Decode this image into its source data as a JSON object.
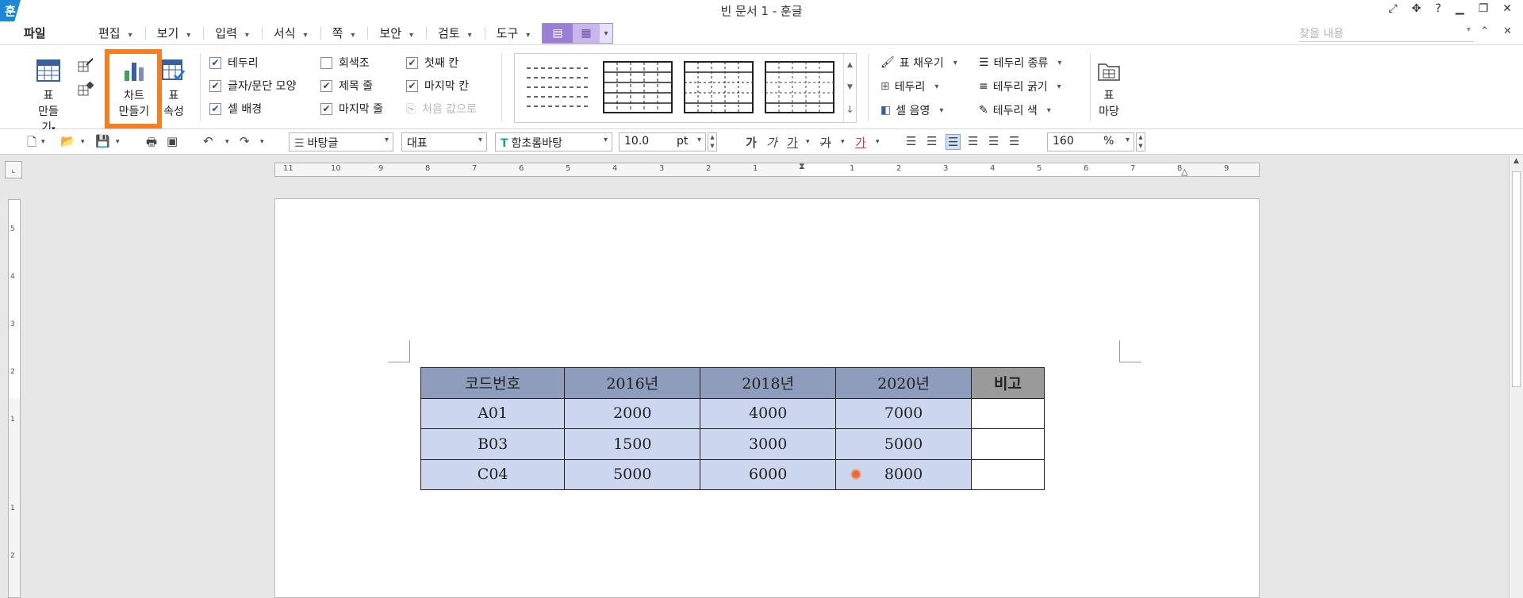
{
  "titlebar": {
    "logo": "훈",
    "title": "빈 문서 1 - 훈글",
    "icons": [
      "fullscreen-icon",
      "move-icon",
      "help-icon",
      "minimize-icon",
      "restore-icon",
      "close-icon"
    ]
  },
  "menu": {
    "file": "파일",
    "items": [
      "편집",
      "보기",
      "입력",
      "서식",
      "쪽",
      "보안",
      "검토",
      "도구"
    ],
    "search_placeholder": "찾을 내용"
  },
  "ribbon": {
    "table_make": {
      "line1": "표",
      "line2": "만들기"
    },
    "chart_make": {
      "line1": "차트",
      "line2": "만들기"
    },
    "table_props": {
      "line1": "표",
      "line2": "속성"
    },
    "checkboxes": [
      {
        "label": "테두리",
        "checked": true
      },
      {
        "label": "글자/문단 모양",
        "checked": true
      },
      {
        "label": "셀 배경",
        "checked": true
      },
      {
        "label": "회색조",
        "checked": false
      },
      {
        "label": "제목 줄",
        "checked": true
      },
      {
        "label": "마지막 줄",
        "checked": true
      },
      {
        "label": "첫째 칸",
        "checked": true
      },
      {
        "label": "마지막 칸",
        "checked": true
      }
    ],
    "reset_label": "처음 값으로",
    "tools": {
      "fill": "표 채우기",
      "border": "테두리",
      "cell_shade": "셀 음영",
      "border_type": "테두리 종류",
      "border_width": "테두리 굵기",
      "border_color": "테두리 색"
    },
    "yard": {
      "line1": "표",
      "line2": "마당"
    }
  },
  "format": {
    "style": "바탕글",
    "lang": "대표",
    "font": "함초롬바탕",
    "size": "10.0",
    "unit": "pt",
    "zoom": "160",
    "zoom_unit": "%"
  },
  "ruler": {
    "h_labels": [
      "11",
      "10",
      "9",
      "8",
      "7",
      "6",
      "5",
      "4",
      "3",
      "2",
      "1",
      "1",
      "2",
      "3",
      "4",
      "5",
      "6",
      "7",
      "8",
      "9"
    ],
    "v_labels": [
      "5",
      "4",
      "3",
      "2",
      "1",
      "1",
      "2"
    ]
  },
  "table": {
    "headers": [
      "코드번호",
      "2016년",
      "2018년",
      "2020년",
      "비고"
    ],
    "rows": [
      [
        "A01",
        "2000",
        "4000",
        "7000",
        ""
      ],
      [
        "B03",
        "1500",
        "3000",
        "5000",
        ""
      ],
      [
        "C04",
        "5000",
        "6000",
        "8000",
        ""
      ]
    ]
  },
  "colors": {
    "accent_highlight": "#f57f20",
    "header_cell": "#8f9dbc",
    "body_cell": "#ccd7ef",
    "view_toggle": "#9b7fd4",
    "logo": "#1e88d6"
  }
}
